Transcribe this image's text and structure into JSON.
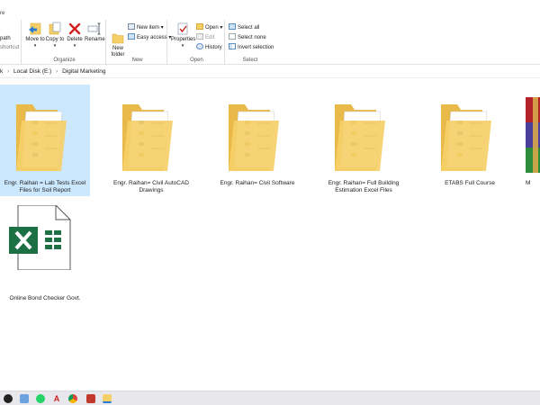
{
  "ribbon": {
    "tab_fragment": "re",
    "clipboard_partial": {
      "path": "path",
      "shortcut": "shortcut"
    },
    "organize": {
      "label": "Organize",
      "move_to": "Move to",
      "copy_to": "Copy to",
      "delete": "Delete",
      "rename": "Rename"
    },
    "new": {
      "label": "New",
      "new_folder": "New folder",
      "new_item": "New item",
      "easy_access": "Easy access"
    },
    "open": {
      "label": "Open",
      "properties": "Properties",
      "open": "Open",
      "edit": "Edit",
      "history": "History"
    },
    "select": {
      "label": "Select",
      "select_all": "Select all",
      "select_none": "Select none",
      "invert_selection": "Invert selection"
    }
  },
  "address": {
    "partial": "k",
    "crumbs": [
      "Local Disk (E:)",
      "Digital Marketing"
    ]
  },
  "items": [
    {
      "label": "Engr. Raihan = Lab Tests Excel Files for Soil Report",
      "type": "folder",
      "selected": true
    },
    {
      "label": "Engr. Raihan= Civil AutoCAD Drawings",
      "type": "folder",
      "selected": false
    },
    {
      "label": "Engr. Raihan= Civil Software",
      "type": "folder",
      "selected": false
    },
    {
      "label": "Engr. Raihan= Full Building Estimation Excel Files",
      "type": "folder",
      "selected": false
    },
    {
      "label": "ETABS Full Course",
      "type": "folder",
      "selected": false
    },
    {
      "label": "M",
      "type": "archive",
      "selected": false
    },
    {
      "label": "Online Bond Checker Govt.",
      "type": "excel",
      "selected": false
    }
  ],
  "colors": {
    "selection": "#cce8ff",
    "folder": "#f5cf68",
    "excel": "#1d7044"
  }
}
